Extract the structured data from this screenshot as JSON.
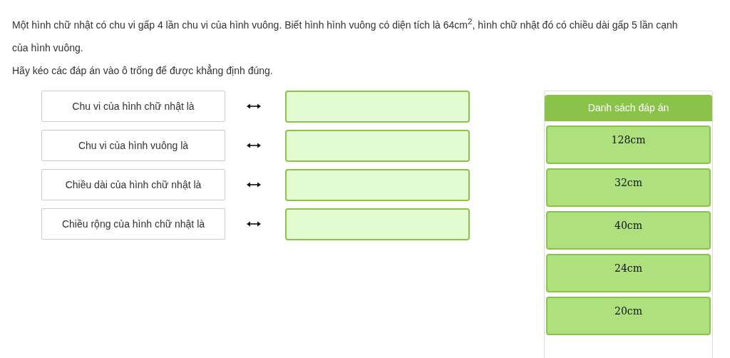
{
  "question": {
    "lines": [
      "Một hình chữ nhật có chu vi gấp 4 lần chu vi của hình vuông. Biết hình hình vuông có diện tích là 64cm$^{2}$, hình chữ nhật đó có chiều dài gấp 5 lần cạnh của hình vuông.",
      "Hãy kéo các đáp án vào ô trống để được khẳng định đúng."
    ]
  },
  "pairs": [
    {
      "label": "Chu vi của hình chữ nhật là"
    },
    {
      "label": "Chu vi của hình vuông là"
    },
    {
      "label": "Chiều dài của hình chữ nhật là"
    },
    {
      "label": "Chiều rộng của hình chữ nhật là"
    }
  ],
  "answer_panel": {
    "title": "Danh sách đáp án",
    "answers": [
      "128cm",
      "32cm",
      "40cm",
      "24cm",
      "20cm"
    ]
  }
}
